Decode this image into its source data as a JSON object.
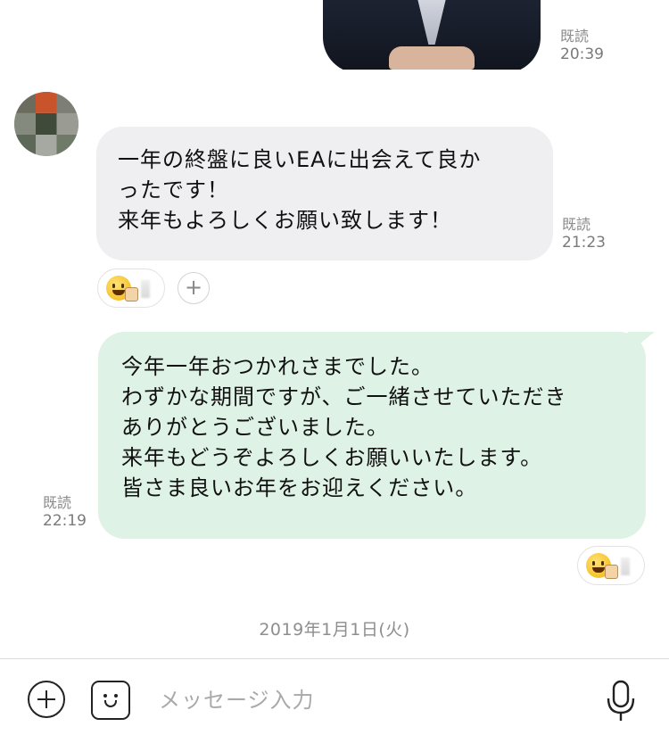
{
  "messages": [
    {
      "id": "m1",
      "direction": "out",
      "type": "image",
      "read_label": "既読",
      "time": "20:39"
    },
    {
      "id": "m2",
      "direction": "in",
      "type": "text",
      "text": "一年の終盤に良いEAに出会えて良か\nったです！\n来年もよろしくお願い致します！",
      "read_label": "既読",
      "time": "21:23",
      "reaction": {
        "icon": "smiley-thumbs-up-icon"
      }
    },
    {
      "id": "m3",
      "direction": "out",
      "type": "text",
      "text": "今年一年おつかれさまでした。\nわずかな期間ですが、ご一緒させていただき\nありがとうございました。\n来年もどうぞよろしくお願いいたします。\n皆さま良いお年をお迎えください。",
      "read_label": "既読",
      "time": "22:19",
      "reaction": {
        "icon": "smiley-thumbs-up-icon"
      }
    }
  ],
  "add_reaction_icon": "plus-icon",
  "date_separator": "2019年1月1日(火)",
  "input_bar": {
    "placeholder": "メッセージ入力",
    "value": "",
    "left_icons": [
      "plus-circle-icon",
      "sticker-icon"
    ],
    "right_icon": "microphone-icon"
  },
  "colors": {
    "incoming_bubble": "#efeff2",
    "outgoing_bubble": "#def2e6",
    "meta_text": "#8a8a8a"
  }
}
